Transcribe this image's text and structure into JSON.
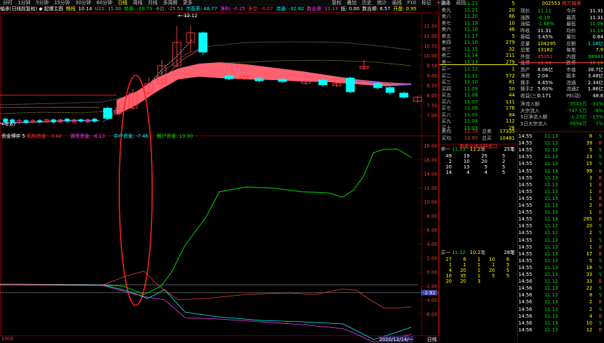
{
  "toolbar": {
    "items": [
      "分时",
      "1分钟",
      "5分钟",
      "15分钟",
      "30分钟",
      "60分钟",
      "日线",
      "周线",
      "月线",
      "多周期",
      "更多"
    ],
    "active": "日线",
    "right": [
      "复权",
      "叠加",
      "历史",
      "统计",
      "画线",
      "F10",
      "标记",
      "+自选",
      "返回"
    ]
  },
  "infobar": {
    "items": [
      {
        "t": "轴承(日线前复权) ◆ 起爆主图",
        "c": "wht"
      },
      {
        "t": "畅线",
        "c": "yel"
      },
      {
        "t": "10.14",
        "c": "wht"
      },
      {
        "t": "U21: 11.00",
        "c": "gry"
      },
      {
        "t": "势板: -19.79",
        "c": "grn"
      },
      {
        "t": "卡位: -25.51",
        "c": "gry"
      },
      {
        "t": "市盈率: 48.77",
        "c": "cyn"
      },
      {
        "t": "净利: -0.25",
        "c": "mag"
      },
      {
        "t": "多空: -0.07",
        "c": "red"
      },
      {
        "t": "流通: -32.92",
        "c": "cyn"
      },
      {
        "t": "数吉顺: 12.13",
        "c": "mag"
      },
      {
        "t": "抵: 0.00",
        "c": "wht"
      },
      {
        "t": "数吉顺: 6.57",
        "c": "wht"
      },
      {
        "t": "开盘: 0.95",
        "c": "yel"
      }
    ]
  },
  "price_axis": {
    "labels": [
      "11.50",
      "11.00",
      "10.50",
      "10.00",
      "9.50",
      "9.00",
      "8.50",
      "8.00",
      "7.50",
      "7.00"
    ]
  },
  "annotations": {
    "high": "12.12",
    "low": "6.67"
  },
  "capital_bar": {
    "items": [
      {
        "t": "资金博弈 5",
        "c": "wht"
      },
      {
        "t": "机构资金: -3.42",
        "c": "red"
      },
      {
        "t": "游资资金: -8.13",
        "c": "mag"
      },
      {
        "t": "中户资金: -7.46",
        "c": "cyn"
      },
      {
        "t": "散户资金: 19.00",
        "c": "grn"
      }
    ]
  },
  "lower_axis": {
    "labels": [
      "18.00",
      "16.00",
      "14.00",
      "12.00",
      "10.00",
      "8.00",
      "6.00",
      "4.00",
      "2.00",
      "0.00",
      "-2.00",
      "-4.00",
      "-6.00"
    ],
    "marker": "-2.92"
  },
  "bottom_bar": {
    "left": "1000",
    "date": "2020/12/14/一",
    "right": "日线"
  },
  "stock": {
    "code": "002553",
    "name": "南方轴承"
  },
  "order_book": {
    "asks": [
      {
        "l": "卖十",
        "p": "11.22",
        "v": "5"
      },
      {
        "l": "卖九",
        "p": "11.21",
        "v": "20"
      },
      {
        "l": "卖八",
        "p": "11.20",
        "v": "86"
      },
      {
        "l": "卖七",
        "p": "11.19",
        "v": "10"
      },
      {
        "l": "卖六",
        "p": "11.18",
        "v": "46"
      },
      {
        "l": "卖五",
        "p": "11.17",
        "v": "5"
      },
      {
        "l": "卖四",
        "p": "11.16",
        "v": "279"
      },
      {
        "l": "卖三",
        "p": "11.15",
        "v": "32"
      },
      {
        "l": "卖二",
        "p": "11.14",
        "v": "211"
      },
      {
        "l": "卖一",
        "p": "11.13",
        "v": "279"
      }
    ],
    "bids": [
      {
        "l": "买一",
        "p": "11.12",
        "v": "1"
      },
      {
        "l": "买二",
        "p": "11.11",
        "v": "572"
      },
      {
        "l": "买三",
        "p": "11.10",
        "v": "81"
      },
      {
        "l": "买四",
        "p": "11.09",
        "v": "50"
      },
      {
        "l": "买五",
        "p": "11.08",
        "v": "44"
      },
      {
        "l": "买六",
        "p": "11.07",
        "v": "111"
      },
      {
        "l": "买七",
        "p": "11.06",
        "v": "176"
      },
      {
        "l": "买八",
        "p": "11.05",
        "v": "84"
      },
      {
        "l": "买九",
        "p": "11.04",
        "v": "112"
      },
      {
        "l": "买十",
        "p": "11.03",
        "v": "26"
      }
    ],
    "sum_ask": {
      "l": "卖均",
      "p": "11.79",
      "l2": "总卖",
      "v": "17335"
    },
    "sum_bid": {
      "l": "买均",
      "p": "10.95",
      "l2": "总买",
      "v": "10481"
    }
  },
  "quote": [
    {
      "l": "现价",
      "v": "11.12",
      "c": "grn",
      "l2": "今开",
      "v2": "11.31",
      "c2": "wht"
    },
    {
      "l": "涨跌",
      "v": "-0.19",
      "c": "grn",
      "l2": "最高",
      "v2": "11.31",
      "c2": "wht"
    },
    {
      "l": "涨幅",
      "v": "-1.68%",
      "c": "grn",
      "l2": "最低",
      "v2": "11.06",
      "c2": "grn"
    },
    {
      "l": "昨收",
      "v": "11.31",
      "c": "wht",
      "l2": "均价",
      "v2": "11.14",
      "c2": "grn"
    },
    {
      "l": "振幅",
      "v": "3.45%",
      "c": "wht",
      "l2": "量比",
      "v2": "0.64",
      "c2": "wht"
    },
    {
      "l": "总量",
      "v": "104295",
      "c": "yel",
      "l2": "总额",
      "v2": "1.16亿",
      "c2": "cyn"
    },
    {
      "l": "总笔",
      "v": "13182",
      "c": "yel",
      "l2": "每笔",
      "v2": "7.9",
      "c2": "yel"
    },
    {
      "l": "外盘",
      "v": "35352",
      "c": "red",
      "l2": "内盘",
      "v2": "68943",
      "c2": "grn"
    },
    {
      "l": "涨停",
      "v": "12.44",
      "c": "red",
      "l2": "跌停",
      "v2": "10.18",
      "c2": "grn"
    },
    {
      "l": "资产",
      "v": "8.06亿",
      "c": "wht",
      "l2": "市值",
      "v2": "38.7亿",
      "c2": "wht"
    },
    {
      "l": "净资",
      "v": "2.04",
      "c": "wht",
      "l2": "股本",
      "v2": "3.48亿",
      "c2": "wht"
    },
    {
      "l": "换手",
      "v": "4.45%",
      "c": "wht",
      "l2": "流通",
      "v2": "2.34亿",
      "c2": "wht"
    },
    {
      "l": "换手Z",
      "v": "5.60%",
      "c": "wht",
      "l2": "流通Z",
      "v2": "1.86亿",
      "c2": "wht"
    },
    {
      "l": "收益(三)",
      "v": "0.171",
      "c": "wht",
      "l2": "PE(动)",
      "v2": "48.8",
      "c2": "wht"
    }
  ],
  "flows": [
    {
      "l": "净流入额",
      "v": "-3543万",
      "c": "grn",
      "v2": "-31%",
      "c2": "grn"
    },
    {
      "l": "大宗流入",
      "v": "-747.5万",
      "c": "grn",
      "v2": "-6%",
      "c2": "grn"
    },
    {
      "l": "5日净流入额",
      "v": "-1.23亿",
      "c": "grn",
      "v2": "-15%",
      "c2": "grn"
    },
    {
      "l": "5日大宗流入",
      "v": "-5658万",
      "c": "grn",
      "v2": "-7%",
      "c2": "grn"
    }
  ],
  "queue": {
    "ask_head": {
      "l": "卖一",
      "p": "11.13",
      "n": "11.2",
      "u": "笔",
      "v": "25笔"
    },
    "ask_rows": [
      [
        "49",
        "19",
        "25",
        "5"
      ],
      [
        "2",
        "10",
        "20",
        "2"
      ],
      [
        "20",
        "13",
        "5",
        "5"
      ],
      [
        "14",
        "4",
        "4",
        "5"
      ]
    ],
    "ask_btn": "查看全速千档盘口",
    "bid_head": {
      "l": "买一",
      "p": "11.12",
      "n": "10.2",
      "u": "笔",
      "v": "28笔"
    },
    "bid_rows": [
      [
        "27",
        "8",
        "1",
        "10",
        "8"
      ],
      [
        "1",
        "1",
        "1",
        "1",
        "5"
      ],
      [
        "4",
        "20",
        "1",
        "20",
        "5"
      ],
      [
        "10",
        "35",
        "1",
        "5",
        "5"
      ],
      [
        "20",
        "20",
        "3",
        "",
        ""
      ]
    ]
  },
  "ticks": [
    {
      "t": "14:55",
      "p": "11.13",
      "v": "8",
      "s": "S"
    },
    {
      "t": "14:55",
      "p": "11.13",
      "v": "39",
      "s": "B"
    },
    {
      "t": "14:55",
      "p": "11.12",
      "v": "5",
      "s": "S"
    },
    {
      "t": "14:55",
      "p": "11.13",
      "v": "23",
      "s": "S"
    },
    {
      "t": "14:55",
      "p": "11.13",
      "v": "15",
      "s": "S"
    },
    {
      "t": "14:55",
      "p": "11.13",
      "v": "99",
      "s": "B"
    },
    {
      "t": "14:55",
      "p": "11.13",
      "v": "3",
      "s": "B"
    },
    {
      "t": "14:55",
      "p": "11.13",
      "v": "1",
      "s": "B"
    },
    {
      "t": "14:55",
      "p": "11.13",
      "v": "1",
      "s": "B"
    },
    {
      "t": "14:55",
      "p": "11.13",
      "v": "1",
      "s": "B"
    },
    {
      "t": "14:55",
      "p": "11.13",
      "v": "2",
      "s": "B"
    },
    {
      "t": "14:55",
      "p": "11.13",
      "v": "1",
      "s": "B"
    },
    {
      "t": "14:55",
      "p": "11.13",
      "v": "265",
      "s": "B"
    },
    {
      "t": "14:55",
      "p": "11.12",
      "v": "20",
      "s": "S"
    },
    {
      "t": "14:55",
      "p": "11.12",
      "v": "2",
      "s": "S"
    },
    {
      "t": "14:55",
      "p": "11.12",
      "v": "1",
      "s": "S"
    },
    {
      "t": "14:55",
      "p": "11.13",
      "v": "1",
      "s": "B"
    },
    {
      "t": "14:55",
      "p": "11.13",
      "v": "17",
      "s": "B"
    },
    {
      "t": "14:55",
      "p": "11.13",
      "v": "5",
      "s": "S"
    },
    {
      "t": "14:55",
      "p": "11.13",
      "v": "18",
      "s": "S"
    },
    {
      "t": "14:55",
      "p": "11.13",
      "v": "33",
      "s": "S"
    },
    {
      "t": "14:56",
      "p": "11.12",
      "v": "33",
      "s": "B"
    },
    {
      "t": "14:56",
      "p": "11.13",
      "v": "22",
      "s": "S"
    },
    {
      "t": "14:56",
      "p": "11.13",
      "v": "8",
      "s": "S"
    },
    {
      "t": "14:56",
      "p": "11.13",
      "v": "2",
      "s": "B"
    },
    {
      "t": "14:56",
      "p": "11.13",
      "v": "2",
      "s": "S"
    },
    {
      "t": "14:56",
      "p": "11.13",
      "v": "4",
      "s": "B"
    },
    {
      "t": "14:56",
      "p": "11.13",
      "v": "10",
      "s": "S"
    },
    {
      "t": "14:56",
      "p": "11.13",
      "v": "12",
      "s": "B"
    }
  ],
  "colors": {
    "up": "#ff3c3c",
    "down": "#00ffff",
    "grid": "#800000",
    "ribbon": "#ff6070",
    "highlight": "#ff2020"
  }
}
